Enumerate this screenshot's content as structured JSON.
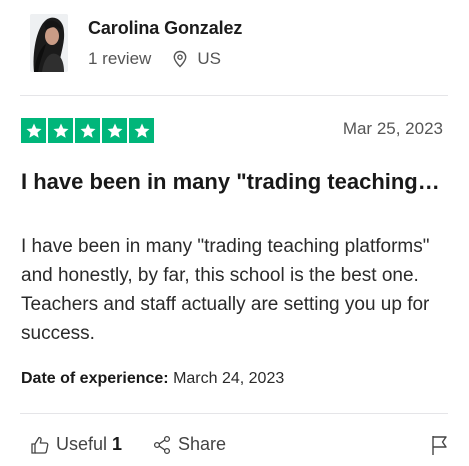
{
  "reviewer": {
    "name": "Carolina Gonzalez",
    "reviews": "1 review",
    "country": "US"
  },
  "review": {
    "rating": 5,
    "rating_color": "#00b67a",
    "date": "Mar 25, 2023",
    "title": "I have been in many \"trading teaching…",
    "body": "I have been in many \"trading teaching platforms\" and honestly, by far, this school is the best one. Teachers and staff actually are setting you up for success.",
    "experience_label": "Date of experience:",
    "experience_date": "March 24, 2023"
  },
  "actions": {
    "useful_label": "Useful",
    "useful_count": "1",
    "share_label": "Share"
  },
  "icons": {
    "location": "location-pin-icon",
    "star": "star-icon",
    "useful": "thumbs-up-icon",
    "share": "share-icon",
    "report": "flag-icon"
  }
}
